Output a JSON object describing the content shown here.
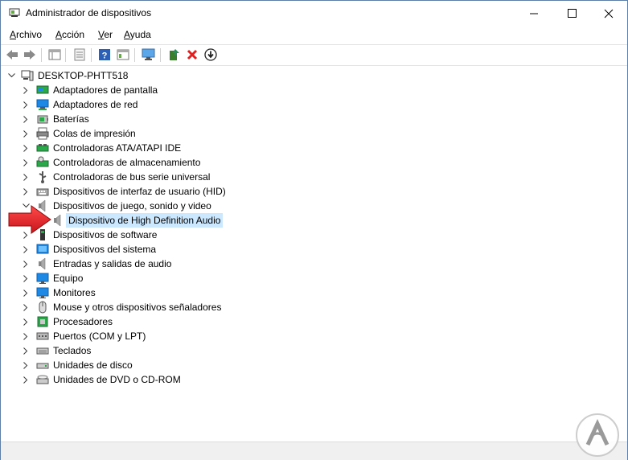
{
  "window": {
    "title": "Administrador de dispositivos",
    "minimize_label": "—",
    "maximize_label": "☐",
    "close_label": "✕"
  },
  "menu": [
    {
      "underline": "A",
      "rest": "rchivo"
    },
    {
      "underline": "A",
      "rest": "cción"
    },
    {
      "underline": "V",
      "rest": "er"
    },
    {
      "underline": "A",
      "rest": "yuda"
    }
  ],
  "tree": {
    "root": "DESKTOP-PHTT518",
    "items": [
      {
        "label": "Adaptadores de pantalla",
        "icon": "display-adapter-icon"
      },
      {
        "label": "Adaptadores de red",
        "icon": "network-adapter-icon"
      },
      {
        "label": "Baterías",
        "icon": "battery-icon"
      },
      {
        "label": "Colas de impresión",
        "icon": "printer-icon"
      },
      {
        "label": "Controladoras ATA/ATAPI IDE",
        "icon": "ide-controller-icon"
      },
      {
        "label": "Controladoras de almacenamiento",
        "icon": "storage-controller-icon"
      },
      {
        "label": "Controladoras de bus serie universal",
        "icon": "usb-icon"
      },
      {
        "label": "Dispositivos de interfaz de usuario (HID)",
        "icon": "hid-icon"
      },
      {
        "label": "Dispositivos de juego, sonido y video",
        "icon": "speaker-icon",
        "expanded": true,
        "children": [
          {
            "label": "Dispositivo de High Definition Audio",
            "icon": "speaker-icon",
            "selected": true
          }
        ]
      },
      {
        "label": "Dispositivos de software",
        "icon": "software-device-icon"
      },
      {
        "label": "Dispositivos del sistema",
        "icon": "system-device-icon"
      },
      {
        "label": "Entradas y salidas de audio",
        "icon": "audio-io-icon"
      },
      {
        "label": "Equipo",
        "icon": "computer-icon"
      },
      {
        "label": "Monitores",
        "icon": "monitor-icon"
      },
      {
        "label": "Mouse y otros dispositivos señaladores",
        "icon": "mouse-icon"
      },
      {
        "label": "Procesadores",
        "icon": "processor-icon"
      },
      {
        "label": "Puertos (COM y LPT)",
        "icon": "port-icon"
      },
      {
        "label": "Teclados",
        "icon": "keyboard-icon"
      },
      {
        "label": "Unidades de disco",
        "icon": "disk-drive-icon"
      },
      {
        "label": "Unidades de DVD o CD-ROM",
        "icon": "dvd-drive-icon"
      }
    ]
  },
  "colors": {
    "selection": "#cce8ff",
    "arrow": "#e8232a",
    "monitor_blue": "#1e88e5"
  }
}
